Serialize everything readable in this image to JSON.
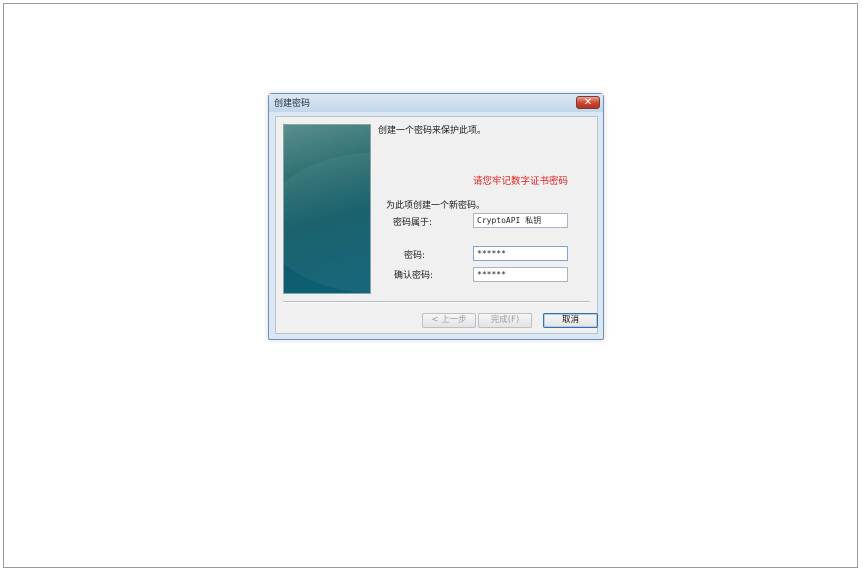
{
  "dialog": {
    "title": "创建密码",
    "close_glyph": "✕",
    "intro": "创建一个密码来保护此项。",
    "warning": "请您牢记数字证书密码",
    "section_label": "为此项创建一个新密码。",
    "fields": {
      "owner_label": "密码属于:",
      "owner_value": "CryptoAPI 私钥",
      "password_label": "密码:",
      "password_value": "******",
      "confirm_label": "确认密码:",
      "confirm_value": "******"
    },
    "buttons": {
      "back": "< 上一步",
      "finish": "完成(F)",
      "cancel": "取消"
    }
  }
}
